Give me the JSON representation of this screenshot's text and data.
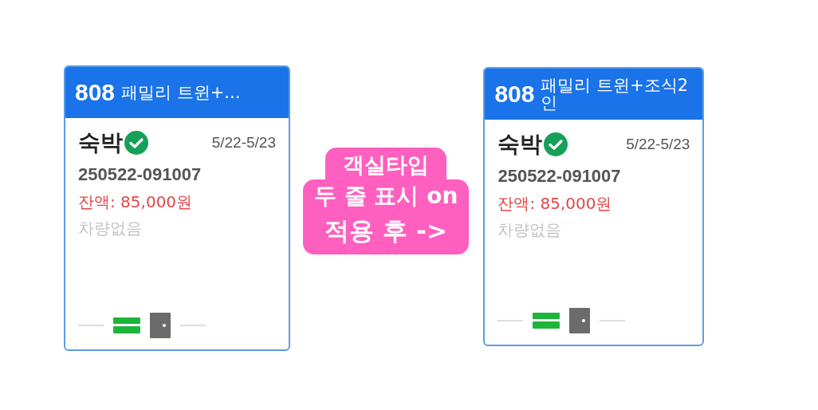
{
  "cards": [
    {
      "room_number": "808",
      "room_type": "패밀리 트윈+...",
      "two_line": false,
      "stay_type": "숙박",
      "confirmed": true,
      "dates": "5/22-5/23",
      "booking_number": "250522-091007",
      "balance": "잔액: 85,000원",
      "vehicle": "차량없음"
    },
    {
      "room_number": "808",
      "room_type": "패밀리 트윈+조식2인",
      "two_line": true,
      "stay_type": "숙박",
      "confirmed": true,
      "dates": "5/22-5/23",
      "booking_number": "250522-091007",
      "balance": "잔액: 85,000원",
      "vehicle": "차량없음"
    }
  ],
  "caption": {
    "lines": [
      "객실타입",
      "두 줄 표시 on",
      "적용 후 ->"
    ]
  }
}
